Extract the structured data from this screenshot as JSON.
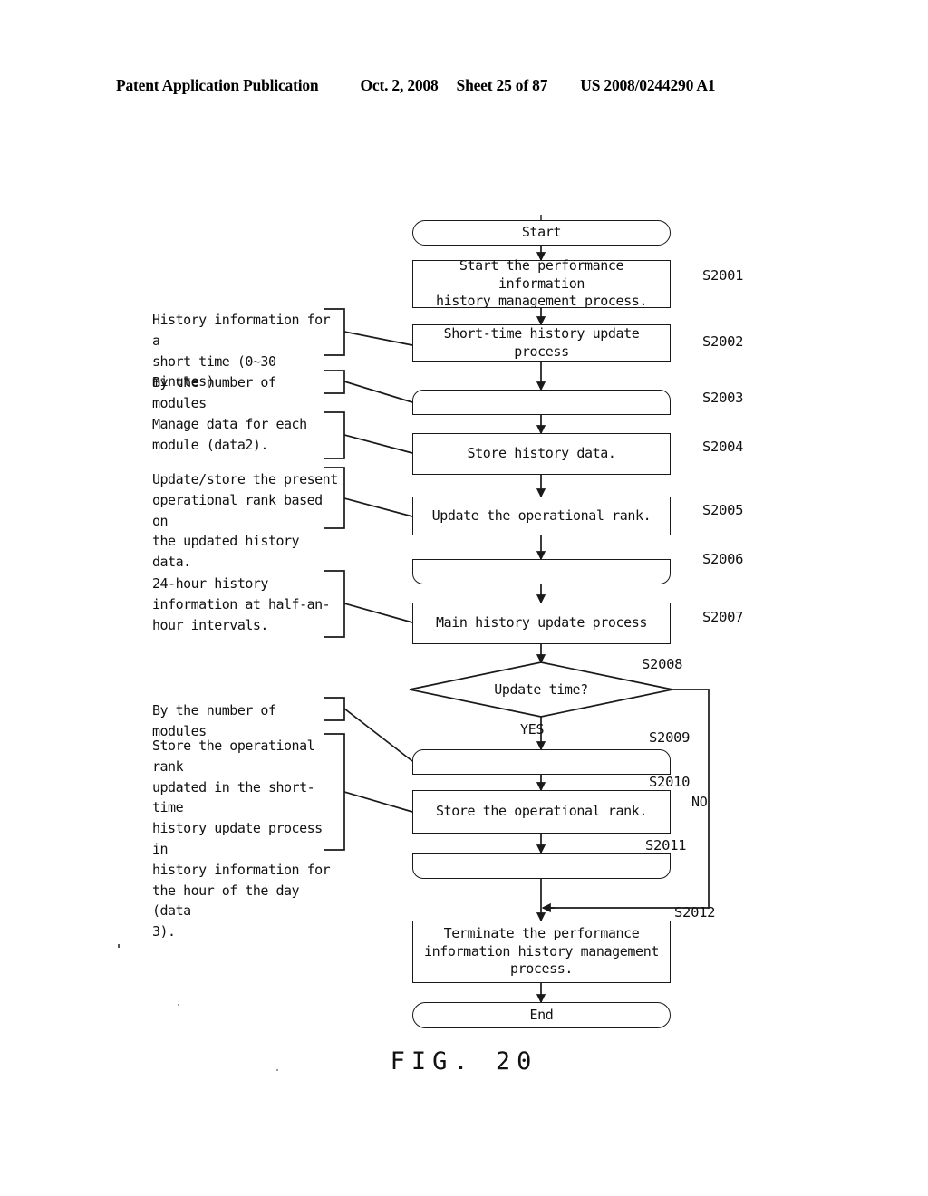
{
  "header": {
    "title": "Patent Application Publication",
    "date": "Oct. 2, 2008",
    "sheet": "Sheet 25 of 87",
    "publication_number": "US 2008/0244290 A1"
  },
  "figure": {
    "caption": "FIG. 20"
  },
  "flowchart": {
    "nodes": [
      {
        "id": "start",
        "label": "Start",
        "shape": "terminator",
        "step": ""
      },
      {
        "id": "s2001",
        "label": "Start the performance information\nhistory management process.",
        "shape": "process",
        "step": "S2001"
      },
      {
        "id": "s2002",
        "label": "Short-time history update process",
        "shape": "process",
        "step": "S2002"
      },
      {
        "id": "s2003",
        "label": "",
        "shape": "loop-start",
        "step": "S2003"
      },
      {
        "id": "s2004",
        "label": "Store history data.",
        "shape": "process",
        "step": "S2004"
      },
      {
        "id": "s2005",
        "label": "Update the operational rank.",
        "shape": "process",
        "step": "S2005"
      },
      {
        "id": "s2006",
        "label": "",
        "shape": "loop-end",
        "step": "S2006"
      },
      {
        "id": "s2007",
        "label": "Main history update process",
        "shape": "process",
        "step": "S2007"
      },
      {
        "id": "s2008",
        "label": "Update time?",
        "shape": "decision",
        "step": "S2008"
      },
      {
        "id": "s2009",
        "label": "",
        "shape": "loop-start",
        "step": "S2009"
      },
      {
        "id": "s2010",
        "label": "Store the operational rank.",
        "shape": "process",
        "step": "S2010"
      },
      {
        "id": "s2011",
        "label": "",
        "shape": "loop-end",
        "step": "S2011"
      },
      {
        "id": "s2012",
        "label": "Terminate the performance\ninformation history management\nprocess.",
        "shape": "process",
        "step": "S2012"
      },
      {
        "id": "end",
        "label": "End",
        "shape": "terminator",
        "step": ""
      }
    ],
    "branches": {
      "yes": "YES",
      "no": "NO"
    }
  },
  "annotations": [
    {
      "id": "a1",
      "text": "History information for a\nshort time (0~30 minutes)",
      "target": "S2002"
    },
    {
      "id": "a2",
      "text": "By the number of modules",
      "target": "S2003"
    },
    {
      "id": "a3",
      "text": "Manage data for each\nmodule (data2).",
      "target": "S2004"
    },
    {
      "id": "a4",
      "text": "Update/store the present\noperational rank based on\nthe updated history data.",
      "target": "S2005"
    },
    {
      "id": "a5",
      "text": "24-hour history\ninformation at half-an-\nhour intervals.",
      "target": "S2007"
    },
    {
      "id": "a6",
      "text": "By the number of modules",
      "target": "S2009"
    },
    {
      "id": "a7",
      "text": "Store the operational rank\nupdated in the short-time\nhistory update process in\nhistory information for\nthe hour of the day (data\n3).",
      "target": "S2010"
    }
  ],
  "colors": {
    "ink": "#111111",
    "page": "#ffffff"
  }
}
